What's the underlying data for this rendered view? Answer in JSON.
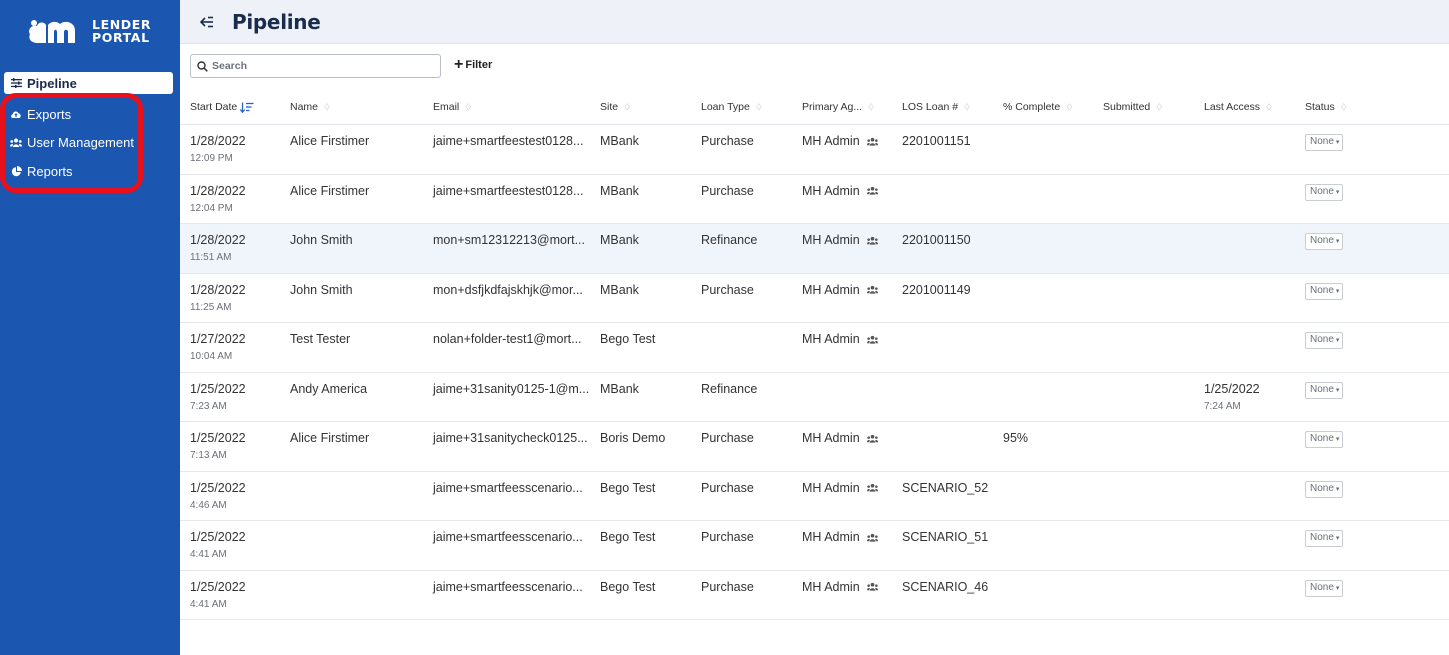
{
  "app": {
    "logo_line1": "LENDER",
    "logo_line2": "PORTAL",
    "brand_color": "#1b56b0",
    "highlight_color": "#e8101a"
  },
  "sidebar": {
    "items": [
      {
        "label": "Pipeline",
        "icon": "list-filter-icon",
        "active": true
      },
      {
        "label": "Exports",
        "icon": "cloud-upload-icon",
        "active": false
      },
      {
        "label": "User Management",
        "icon": "users-icon",
        "active": false
      },
      {
        "label": "Reports",
        "icon": "pie-chart-icon",
        "active": false
      }
    ]
  },
  "header": {
    "title": "Pipeline",
    "back_icon": "collapse-arrow-icon"
  },
  "toolbar": {
    "search_placeholder": "Search",
    "filter_label": "Filter"
  },
  "table": {
    "columns": [
      "Start Date",
      "Name",
      "Email",
      "Site",
      "Loan Type",
      "Primary Ag...",
      "LOS Loan #",
      "% Complete",
      "Submitted",
      "Last Access",
      "Status"
    ],
    "rows": [
      {
        "date": "1/28/2022",
        "time": "12:09 PM",
        "name": "Alice Firstimer",
        "email": "jaime+smartfeestest0128...",
        "site": "MBank",
        "loan_type": "Purchase",
        "agent": "MH Admin",
        "los": "2201001151",
        "complete": "",
        "submitted": "",
        "last_access": "",
        "last_access_time": "",
        "status": "None"
      },
      {
        "date": "1/28/2022",
        "time": "12:04 PM",
        "name": "Alice Firstimer",
        "email": "jaime+smartfeestest0128...",
        "site": "MBank",
        "loan_type": "Purchase",
        "agent": "MH Admin",
        "los": "",
        "complete": "",
        "submitted": "",
        "last_access": "",
        "last_access_time": "",
        "status": "None"
      },
      {
        "date": "1/28/2022",
        "time": "11:51 AM",
        "name": "John Smith",
        "email": "mon+sm12312213@mort...",
        "site": "MBank",
        "loan_type": "Refinance",
        "agent": "MH Admin",
        "los": "2201001150",
        "complete": "",
        "submitted": "",
        "last_access": "",
        "last_access_time": "",
        "status": "None"
      },
      {
        "date": "1/28/2022",
        "time": "11:25 AM",
        "name": "John Smith",
        "email": "mon+dsfjkdfajskhjk@mor...",
        "site": "MBank",
        "loan_type": "Purchase",
        "agent": "MH Admin",
        "los": "2201001149",
        "complete": "",
        "submitted": "",
        "last_access": "",
        "last_access_time": "",
        "status": "None"
      },
      {
        "date": "1/27/2022",
        "time": "10:04 AM",
        "name": "Test Tester",
        "email": "nolan+folder-test1@mort...",
        "site": "Bego Test",
        "loan_type": "",
        "agent": "MH Admin",
        "los": "",
        "complete": "",
        "submitted": "",
        "last_access": "",
        "last_access_time": "",
        "status": "None"
      },
      {
        "date": "1/25/2022",
        "time": "7:23 AM",
        "name": "Andy America",
        "email": "jaime+31sanity0125-1@m...",
        "site": "MBank",
        "loan_type": "Refinance",
        "agent": "",
        "los": "",
        "complete": "",
        "submitted": "",
        "last_access": "1/25/2022",
        "last_access_time": "7:24 AM",
        "status": "None"
      },
      {
        "date": "1/25/2022",
        "time": "7:13 AM",
        "name": "Alice Firstimer",
        "email": "jaime+31sanitycheck0125...",
        "site": "Boris Demo",
        "loan_type": "Purchase",
        "agent": "MH Admin",
        "los": "",
        "complete": "95%",
        "submitted": "",
        "last_access": "",
        "last_access_time": "",
        "status": "None"
      },
      {
        "date": "1/25/2022",
        "time": "4:46 AM",
        "name": "",
        "email": "jaime+smartfeesscenario...",
        "site": "Bego Test",
        "loan_type": "Purchase",
        "agent": "MH Admin",
        "los": "SCENARIO_52",
        "complete": "",
        "submitted": "",
        "last_access": "",
        "last_access_time": "",
        "status": "None"
      },
      {
        "date": "1/25/2022",
        "time": "4:41 AM",
        "name": "",
        "email": "jaime+smartfeesscenario...",
        "site": "Bego Test",
        "loan_type": "Purchase",
        "agent": "MH Admin",
        "los": "SCENARIO_51",
        "complete": "",
        "submitted": "",
        "last_access": "",
        "last_access_time": "",
        "status": "None"
      },
      {
        "date": "1/25/2022",
        "time": "4:41 AM",
        "name": "",
        "email": "jaime+smartfeesscenario...",
        "site": "Bego Test",
        "loan_type": "Purchase",
        "agent": "MH Admin",
        "los": "SCENARIO_46",
        "complete": "",
        "submitted": "",
        "last_access": "",
        "last_access_time": "",
        "status": "None"
      }
    ]
  }
}
